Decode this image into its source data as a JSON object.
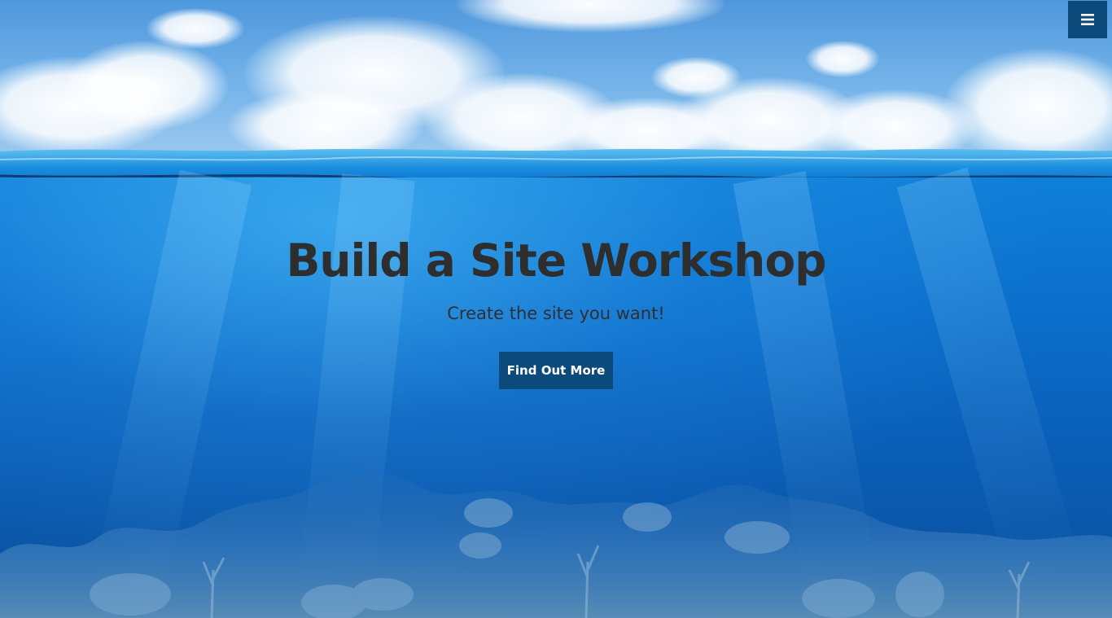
{
  "hero": {
    "title": "Build a Site Workshop",
    "subtitle": "Create the site you want!",
    "cta_label": "Find Out More"
  },
  "nav": {
    "menu_icon": "hamburger-menu-icon"
  },
  "colors": {
    "button_bg": "#0d4a7c",
    "button_text": "#ffffff",
    "title_text": "#2e2e2e",
    "water": "#0b6fcc",
    "sky": "#6fb0e8"
  }
}
